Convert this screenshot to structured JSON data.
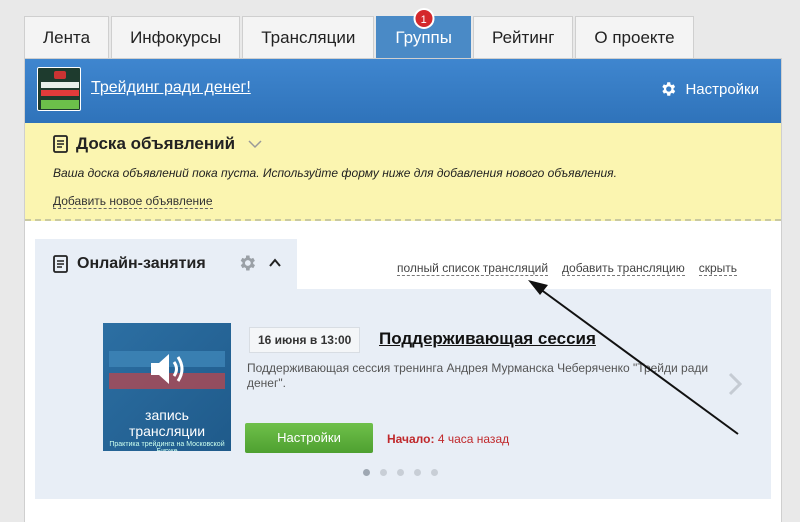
{
  "tabs": [
    {
      "label": "Лента"
    },
    {
      "label": "Инфокурсы"
    },
    {
      "label": "Трансляции"
    },
    {
      "label": "Группы",
      "badge": "1"
    },
    {
      "label": "Рейтинг"
    },
    {
      "label": "О проекте"
    }
  ],
  "group": {
    "title": "Трейдинг ради денег!",
    "settings_label": "Настройки",
    "logo_icon": "group-logo-image"
  },
  "board": {
    "title": "Доска объявлений",
    "empty_text": "Ваша доска объявлений пока пуста. Используйте форму ниже для добавления нового объявления.",
    "add_link": "Добавить новое объявление"
  },
  "online": {
    "title": "Онлайн-занятия",
    "links": {
      "full_list": "полный список трансляций",
      "add": "добавить трансляцию",
      "hide": "скрыть"
    },
    "session": {
      "date": "16 июня в 13:00",
      "title": "Поддерживающая сессия",
      "description": "Поддерживающая сессия тренинга Андрея Мурманска Чеберяченко \"Трейди ради денег\".",
      "thumb_caption_1": "запись",
      "thumb_caption_2": "трансляции",
      "thumb_caption_3": "Практика трейдинга на Московской Бирже",
      "button_label": "Настройки",
      "start_label": "Начало:",
      "start_value": "4 часа назад"
    }
  },
  "colors": {
    "accent_blue": "#3f86cf",
    "green_button": "#5cb03a",
    "warning_red": "#c0282b",
    "board_yellow": "#fbf5b0"
  }
}
